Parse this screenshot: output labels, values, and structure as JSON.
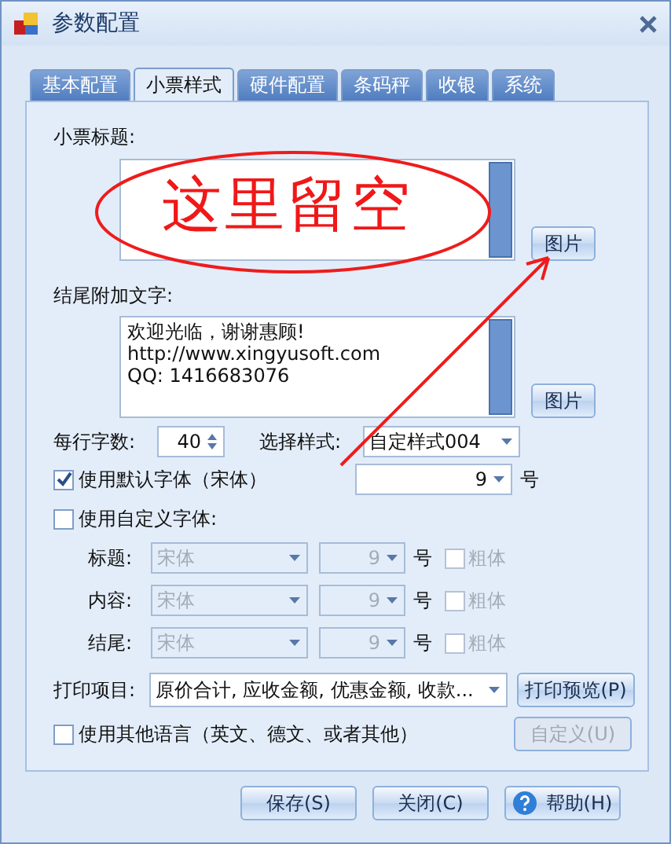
{
  "window": {
    "title": "参数配置"
  },
  "tabs": [
    {
      "label": "基本配置",
      "selected": false
    },
    {
      "label": "小票样式",
      "selected": true
    },
    {
      "label": "硬件配置",
      "selected": false
    },
    {
      "label": "条码秤",
      "selected": false
    },
    {
      "label": "收银",
      "selected": false
    },
    {
      "label": "系统",
      "selected": false
    }
  ],
  "receipt_title": {
    "label": "小票标题:",
    "picture_button": "图片"
  },
  "footer_text": {
    "label": "结尾附加文字:",
    "lines": [
      "欢迎光临，谢谢惠顾!",
      "http://www.xingyusoft.com",
      "QQ: 1416683076"
    ],
    "picture_button": "图片"
  },
  "chars_per_line": {
    "label": "每行字数:",
    "value": "40"
  },
  "style": {
    "label": "选择样式:",
    "value": "自定样式004"
  },
  "default_font": {
    "label": "使用默认字体（宋体）",
    "checked": true,
    "size": "9",
    "unit": "号"
  },
  "custom_font": {
    "label": "使用自定义字体:",
    "checked": false,
    "rows": [
      {
        "label": "标题:",
        "font": "宋体",
        "size": "9",
        "unit": "号",
        "bold_label": "粗体",
        "bold": false,
        "disabled": true
      },
      {
        "label": "内容:",
        "font": "宋体",
        "size": "9",
        "unit": "号",
        "bold_label": "粗体",
        "bold": false,
        "disabled": true
      },
      {
        "label": "结尾:",
        "font": "宋体",
        "size": "9",
        "unit": "号",
        "bold_label": "粗体",
        "bold": false,
        "disabled": true
      }
    ]
  },
  "print_items": {
    "label": "打印项目:",
    "value": "原价合计, 应收金额, 优惠金额, 收款...",
    "button": "打印预览(P)"
  },
  "other_language": {
    "label": "使用其他语言（英文、德文、或者其他）",
    "checked": false,
    "button": "自定义(U)",
    "button_disabled": true
  },
  "buttons": [
    {
      "label": "保存(S)",
      "kind": "plain"
    },
    {
      "label": "关闭(C)",
      "kind": "plain"
    },
    {
      "label": "帮助(H)",
      "kind": "help"
    }
  ],
  "annotation": {
    "text": "这里留空"
  }
}
